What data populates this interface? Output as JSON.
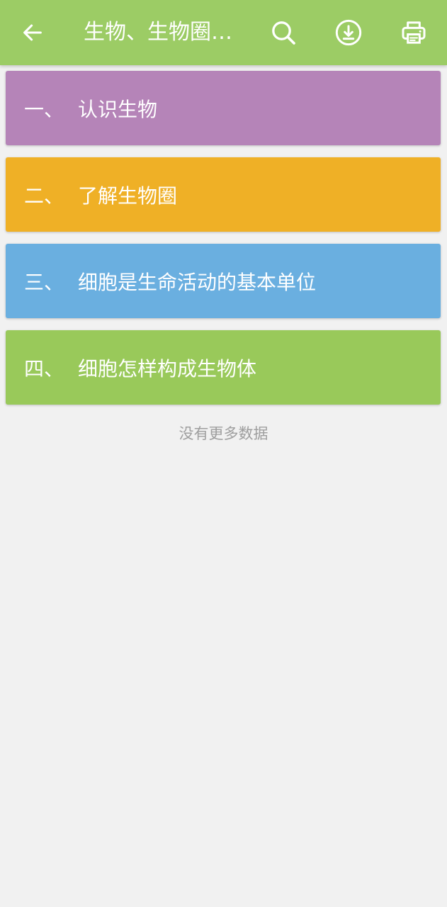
{
  "appbar": {
    "title": "生物、生物圈与生物分类",
    "background": "#9ccc65",
    "icons": [
      "back-arrow-icon",
      "search-icon",
      "download-icon",
      "print-icon"
    ]
  },
  "chapters": [
    {
      "num": "一、",
      "label": "认识生物",
      "color": "#b584b8"
    },
    {
      "num": "二、",
      "label": "了解生物圈",
      "color": "#efb026"
    },
    {
      "num": "三、",
      "label": "细胞是生命活动的基本单位",
      "color": "#6aafe0"
    },
    {
      "num": "四、",
      "label": "细胞怎样构成生物体",
      "color": "#99c95a"
    }
  ],
  "footer": {
    "text": "没有更多数据"
  }
}
